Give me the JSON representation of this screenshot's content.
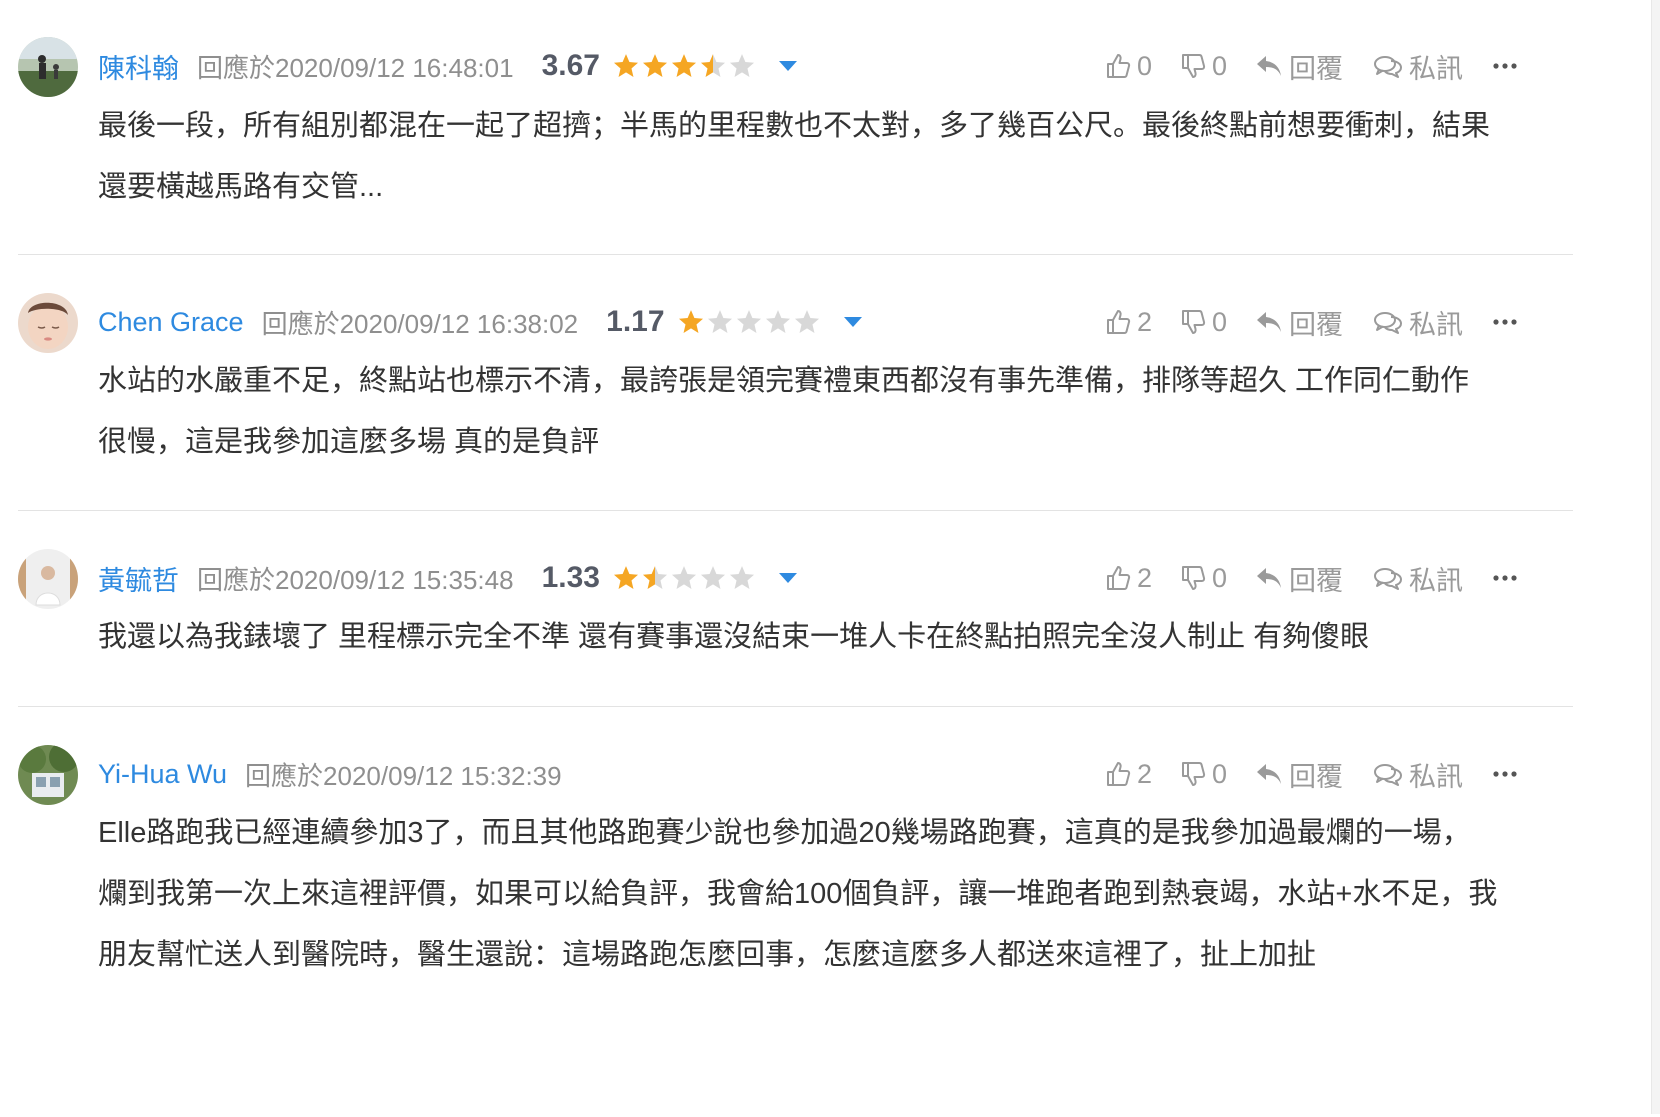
{
  "comments": [
    {
      "author": "陳科翰",
      "timestamp": "回應於2020/09/12 16:48:01",
      "score": "3.67",
      "rating": 3.67,
      "likes": "0",
      "dislikes": "0",
      "reply_label": "回覆",
      "message_label": "私訊",
      "text": "最後一段，所有組別都混在一起了超擠；半馬的里程數也不太對，多了幾百公尺。最後終點前想要衝刺，結果還要橫越馬路有交管..."
    },
    {
      "author": "Chen Grace",
      "timestamp": "回應於2020/09/12 16:38:02",
      "score": "1.17",
      "rating": 1.17,
      "likes": "2",
      "dislikes": "0",
      "reply_label": "回覆",
      "message_label": "私訊",
      "text": "水站的水嚴重不足，終點站也標示不清，最誇張是領完賽禮東西都沒有事先準備，排隊等超久 工作同仁動作很慢，這是我參加這麼多場 真的是負評"
    },
    {
      "author": "黃毓哲",
      "timestamp": "回應於2020/09/12 15:35:48",
      "score": "1.33",
      "rating": 1.33,
      "likes": "2",
      "dislikes": "0",
      "reply_label": "回覆",
      "message_label": "私訊",
      "text": "我還以為我錶壞了 里程標示完全不準 還有賽事還沒結束一堆人卡在終點拍照完全沒人制止 有夠傻眼"
    },
    {
      "author": "Yi-Hua Wu",
      "timestamp": "回應於2020/09/12 15:32:39",
      "likes": "2",
      "dislikes": "0",
      "reply_label": "回覆",
      "message_label": "私訊",
      "text": "Elle路跑我已經連續參加3了，而且其他路跑賽少說也參加過20幾場路跑賽，這真的是我參加過最爛的一場，爛到我第一次上來這裡評價，如果可以給負評，我會給100個負評，讓一堆跑者跑到熱衰竭，水站+水不足，我朋友幫忙送人到醫院時，醫生還說：這場路跑怎麼回事，怎麼這麼多人都送來這裡了，扯上加扯"
    }
  ],
  "icons": {
    "like": "thumbs-up-icon",
    "dislike": "thumbs-down-icon",
    "reply": "reply-arrow-icon",
    "message": "chat-bubbles-icon",
    "more": "more-dots-icon",
    "caret": "caret-down-icon"
  },
  "colors": {
    "author": "#2e8ae0",
    "star_filled": "#f5a623",
    "star_empty": "#d8d8d8",
    "caret": "#2e8ae0",
    "muted": "#9a9a9a"
  }
}
